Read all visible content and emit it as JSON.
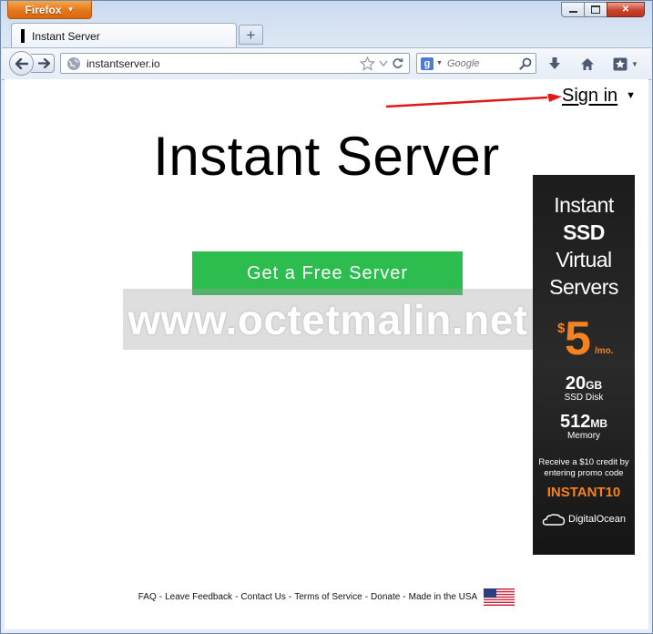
{
  "browser": {
    "app_menu_label": "Firefox",
    "tab_title": "Instant Server",
    "new_tab_label": "+",
    "url": "instantserver.io",
    "search_placeholder": "Google"
  },
  "page": {
    "sign_in_label": "Sign in",
    "sign_in_caret": "▼",
    "title": "Instant Server",
    "cta_label": "Get a Free Server",
    "watermark": "www.octetmalin.net"
  },
  "ad": {
    "line1": "Instant",
    "line2": "SSD",
    "line3": "Virtual",
    "line4": "Servers",
    "price_currency": "$",
    "price_value": "5",
    "price_period": "/mo.",
    "disk_value": "20",
    "disk_unit": "GB",
    "disk_label": "SSD Disk",
    "memory_value": "512",
    "memory_unit": "MB",
    "memory_label": "Memory",
    "promo_line1": "Receive a $10 credit by",
    "promo_line2": "entering promo code",
    "promo_code": "INSTANT10",
    "brand": "DigitalOcean",
    "accent_color": "#f58220"
  },
  "footer": {
    "links": [
      "FAQ",
      "Leave Feedback",
      "Contact Us",
      "Terms of Service",
      "Donate",
      "Made in the USA"
    ]
  },
  "colors": {
    "cta_green": "#2dbc4e",
    "firefox_orange": "#e3741a",
    "arrow_red": "#e01818"
  }
}
